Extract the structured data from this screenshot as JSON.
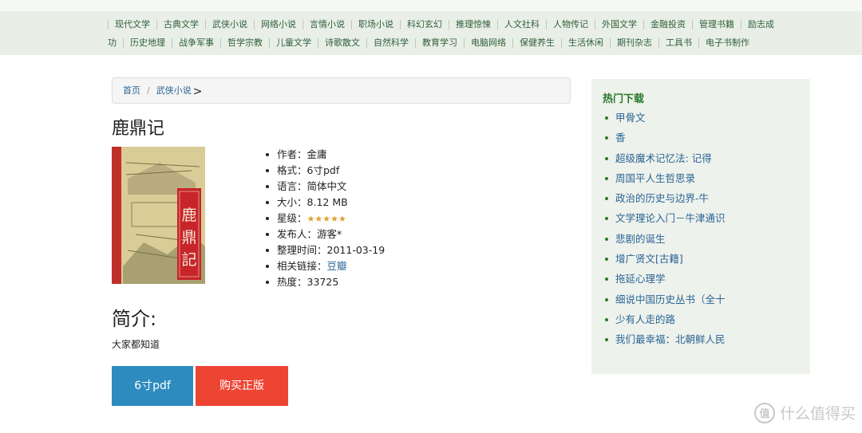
{
  "nav": {
    "row1": [
      "现代文学",
      "古典文学",
      "武侠小说",
      "网络小说",
      "言情小说",
      "职场小说",
      "科幻玄幻",
      "推理惊悚",
      "人文社科",
      "人物传记",
      "外国文学",
      "金融投资",
      "管理书籍",
      "励志成"
    ],
    "row2": [
      "功",
      "历史地理",
      "战争军事",
      "哲学宗教",
      "儿童文学",
      "诗歌散文",
      "自然科学",
      "教育学习",
      "电脑网络",
      "保健养生",
      "生活休闲",
      "期刊杂志",
      "工具书",
      "电子书制作"
    ]
  },
  "breadcrumb": {
    "home": "首页",
    "separator": "/",
    "category": "武侠小说",
    "trail": ">"
  },
  "book": {
    "title": "鹿鼎记",
    "cover_text": "鹿鼎記",
    "info": [
      {
        "label": "作者：",
        "value": "金庸"
      },
      {
        "label": "格式：",
        "value": "6寸pdf"
      },
      {
        "label": "语言：",
        "value": "简体中文"
      },
      {
        "label": "大小：",
        "value": "8.12 MB"
      },
      {
        "label": "星级：",
        "value": ""
      },
      {
        "label": "发布人：",
        "value": "游客*"
      },
      {
        "label": "整理时间：",
        "value": "2011-03-19"
      },
      {
        "label": "相关链接：",
        "value": "豆瓣"
      },
      {
        "label": "热度：",
        "value": "33725"
      }
    ],
    "rating_stars": 5,
    "star_glyph": "★"
  },
  "intro": {
    "heading": "简介:",
    "text": "大家都知道"
  },
  "buttons": {
    "download": "6寸pdf",
    "buy": "购买正版"
  },
  "sidebar": {
    "title": "热门下载",
    "items": [
      "甲骨文",
      "香",
      "超级魔术记忆法: 记得",
      "周国平人生哲思录",
      "政治的历史与边界-牛",
      "文学理论入门－牛津通识",
      "悲剧的诞生",
      "增广贤文[古籍]",
      "拖延心理学",
      "细说中国历史丛书（全十",
      "少有人走的路",
      "我们最幸福：北朝鲜人民"
    ]
  },
  "watermark": {
    "icon": "值",
    "text": "什么值得买"
  },
  "colors": {
    "nav_bg": "#e9efe6",
    "link": "#2a6496",
    "download_button": "#2e8bc0",
    "buy_button": "#ee4433",
    "sidebar_title": "#2a7a2a",
    "star": "#e0a030"
  }
}
